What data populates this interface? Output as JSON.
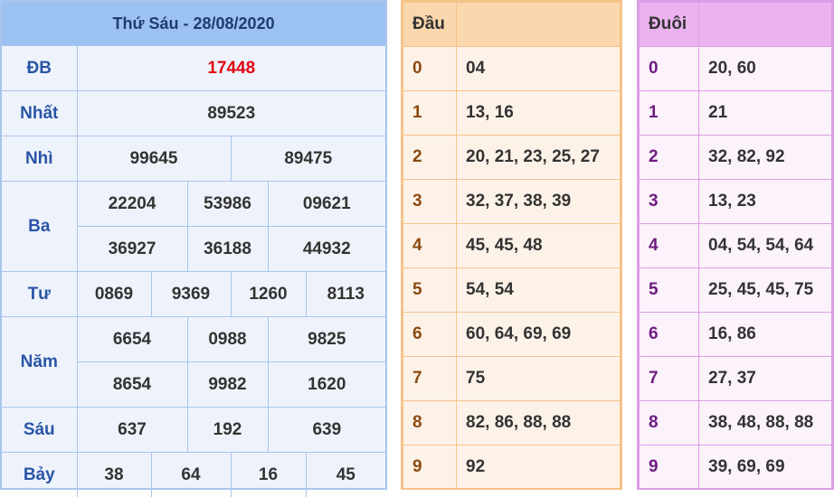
{
  "results": {
    "title": "Thứ Sáu - 28/08/2020",
    "db": {
      "label": "ĐB",
      "value": "17448"
    },
    "nhat": {
      "label": "Nhất",
      "value": "89523"
    },
    "nhi": {
      "label": "Nhì",
      "values": [
        "99645",
        "89475"
      ]
    },
    "ba": {
      "label": "Ba",
      "row1": [
        "22204",
        "53986",
        "09621"
      ],
      "row2": [
        "36927",
        "36188",
        "44932"
      ]
    },
    "tu": {
      "label": "Tư",
      "values": [
        "0869",
        "9369",
        "1260",
        "8113"
      ]
    },
    "nam": {
      "label": "Năm",
      "row1": [
        "6654",
        "0988",
        "9825"
      ],
      "row2": [
        "8654",
        "9982",
        "1620"
      ]
    },
    "sau": {
      "label": "Sáu",
      "values": [
        "637",
        "192",
        "639"
      ]
    },
    "bay": {
      "label": "Bảy",
      "values": [
        "38",
        "64",
        "16",
        "45"
      ]
    }
  },
  "dau": {
    "header": "Đầu",
    "rows": [
      {
        "key": "0",
        "value": "04"
      },
      {
        "key": "1",
        "value": "13, 16"
      },
      {
        "key": "2",
        "value": "20, 21, 23, 25, 27"
      },
      {
        "key": "3",
        "value": "32, 37, 38, 39"
      },
      {
        "key": "4",
        "value": "45, 45, 48"
      },
      {
        "key": "5",
        "value": "54, 54"
      },
      {
        "key": "6",
        "value": "60, 64, 69, 69"
      },
      {
        "key": "7",
        "value": "75"
      },
      {
        "key": "8",
        "value": "82, 86, 88, 88"
      },
      {
        "key": "9",
        "value": "92"
      }
    ]
  },
  "duoi": {
    "header": "Đuôi",
    "rows": [
      {
        "key": "0",
        "value": "20, 60"
      },
      {
        "key": "1",
        "value": "21"
      },
      {
        "key": "2",
        "value": "32, 82, 92"
      },
      {
        "key": "3",
        "value": "13, 23"
      },
      {
        "key": "4",
        "value": "04, 54, 54, 64"
      },
      {
        "key": "5",
        "value": "25, 45, 45, 75"
      },
      {
        "key": "6",
        "value": "16, 86"
      },
      {
        "key": "7",
        "value": "27, 37"
      },
      {
        "key": "8",
        "value": "38, 48, 88, 88"
      },
      {
        "key": "9",
        "value": "39, 69, 69"
      }
    ]
  },
  "colors": {
    "results_header_bg": "#9cc2f2",
    "results_border": "#a8c5ee",
    "special_prize": "#e30613",
    "dau_header_bg": "#fbd7ae",
    "dau_border": "#f6c38a",
    "duoi_header_bg": "#eab3f0",
    "duoi_border": "#dd9de6"
  }
}
